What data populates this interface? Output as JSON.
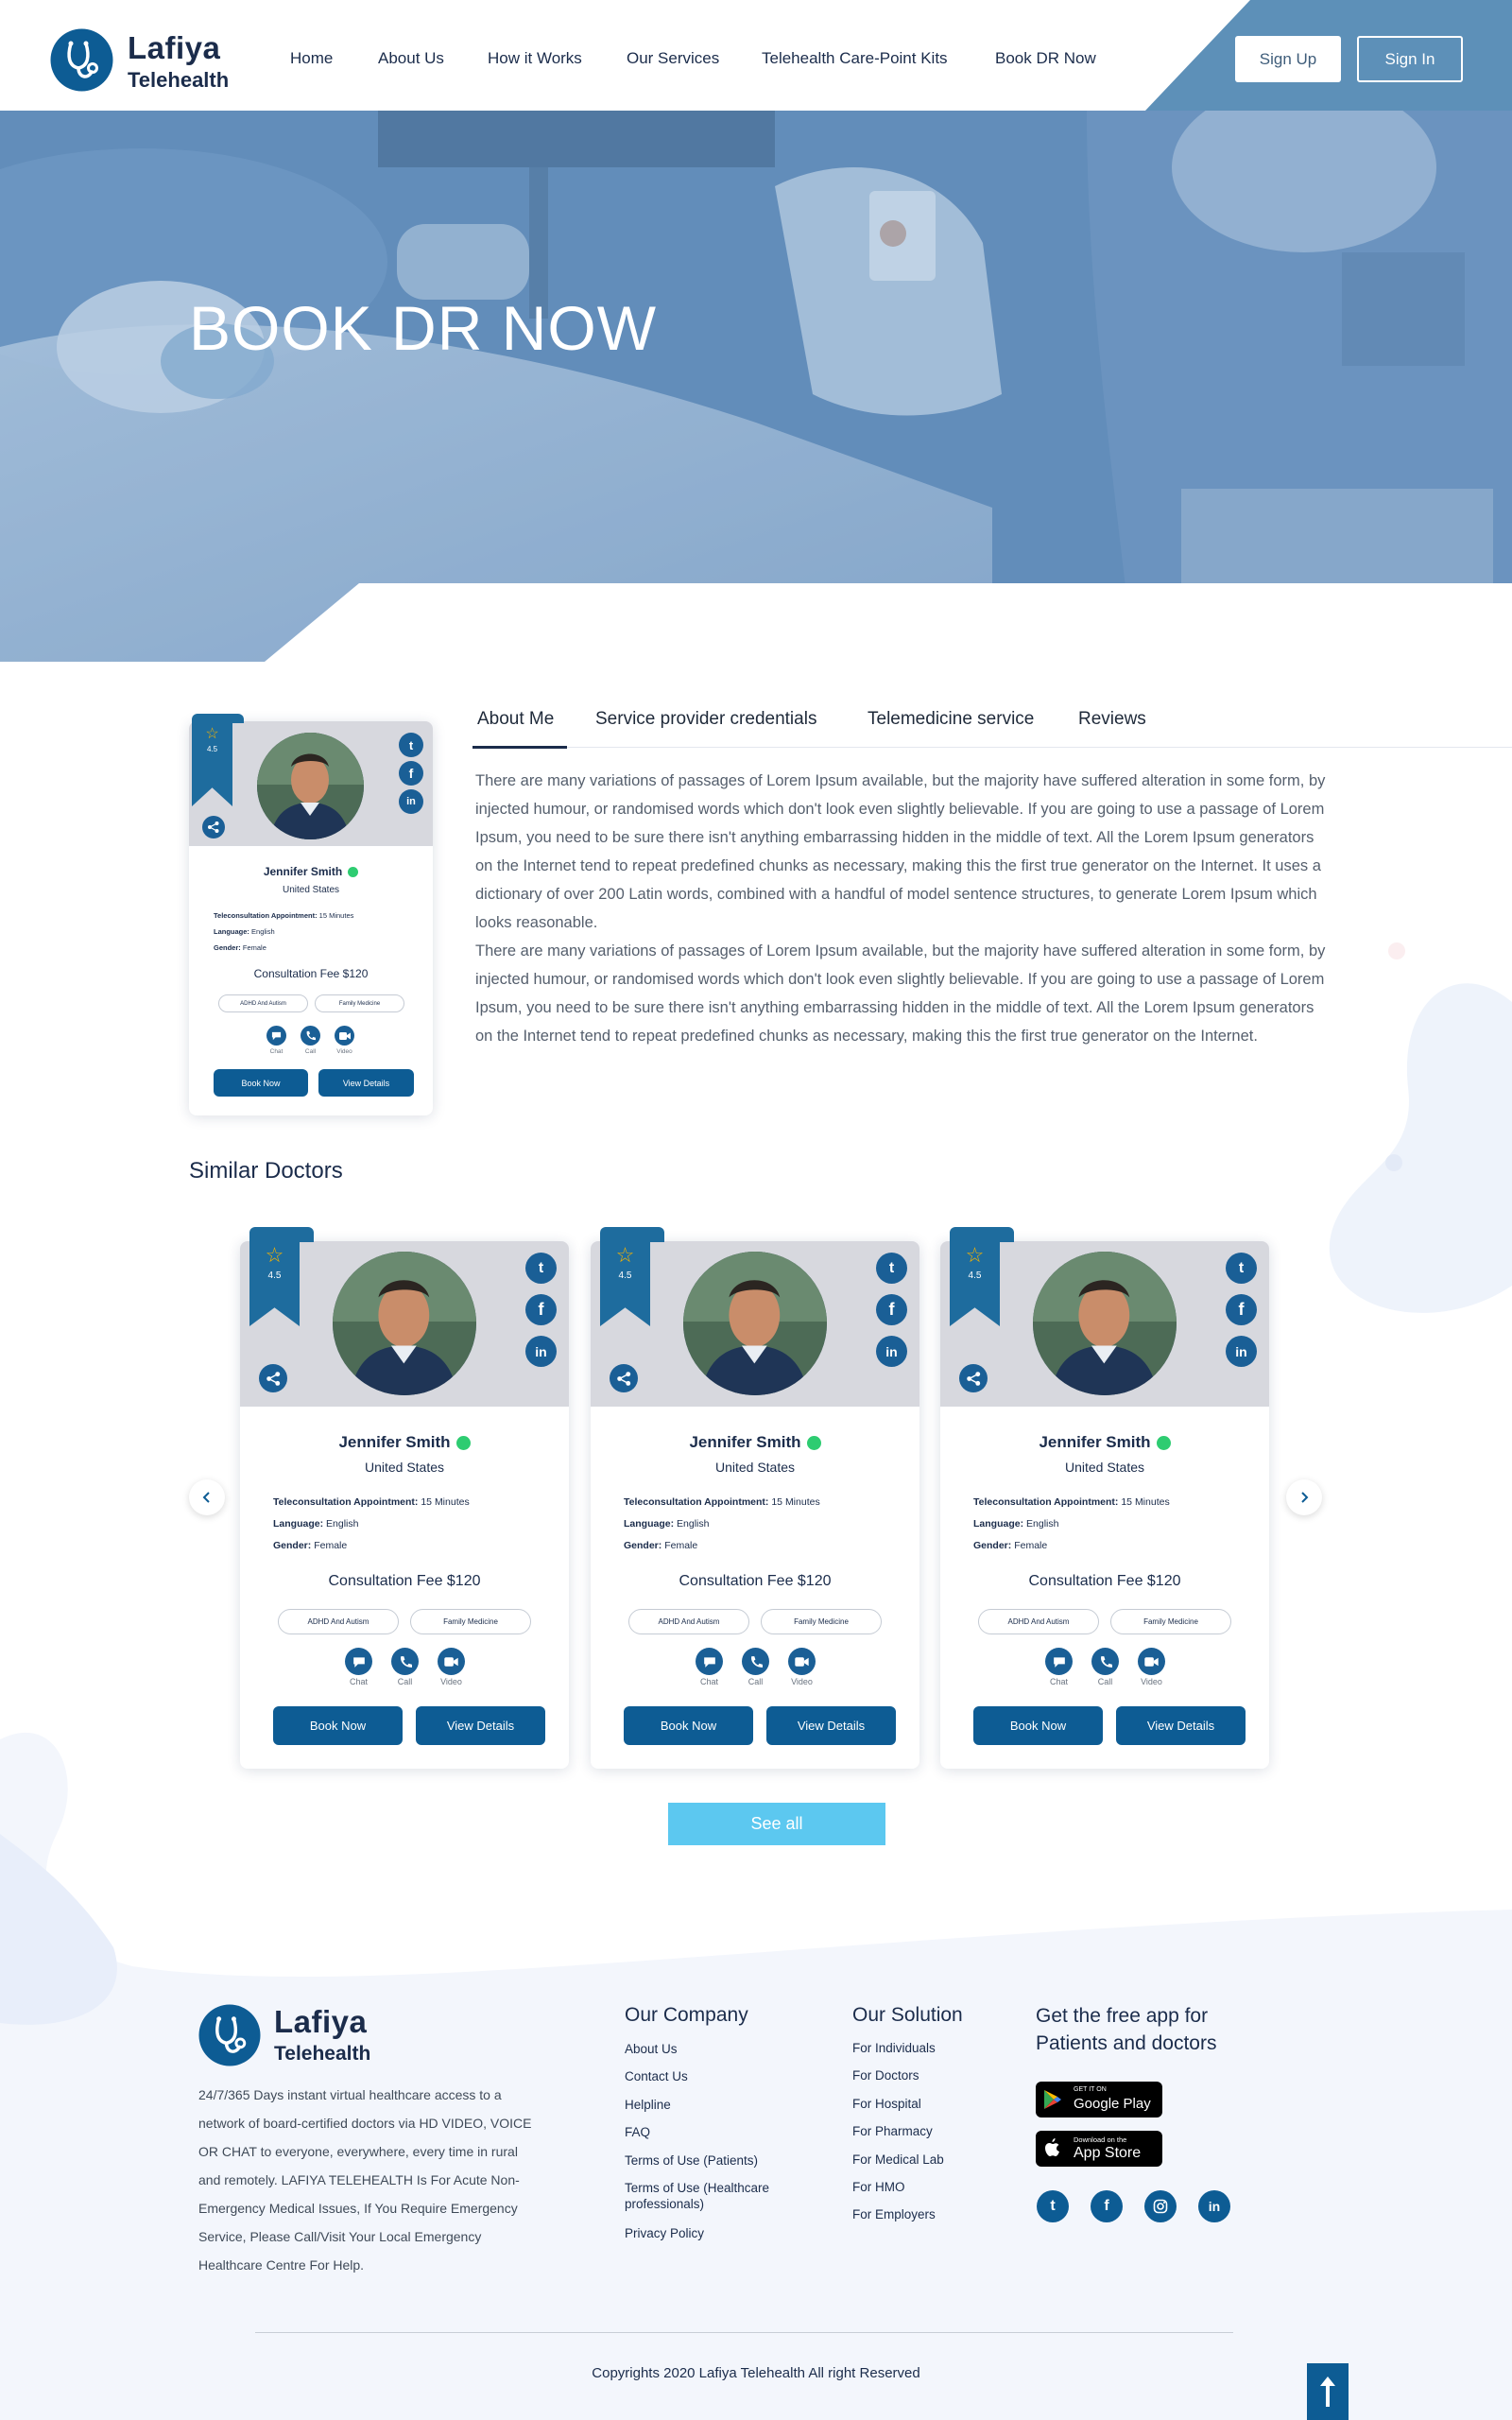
{
  "brand": {
    "name": "Lafiya",
    "sub": "Telehealth"
  },
  "nav": {
    "items": [
      "Home",
      "About Us",
      "How it Works",
      "Our Services",
      "Telehealth Care-Point Kits",
      "Book DR Now"
    ],
    "signup": "Sign Up",
    "signin": "Sign In"
  },
  "hero": {
    "title": "BOOK DR NOW"
  },
  "profile": {
    "tabs": [
      "About Me",
      "Service provider credentials",
      "Telemedicine service",
      "Reviews"
    ],
    "active_tab": "About Me",
    "about_paragraphs": [
      "There are many variations of passages of Lorem Ipsum available, but the majority have suffered alteration in some form, by injected humour, or randomised words which don't look even slightly believable. If you are going to use a passage of Lorem Ipsum, you need to be sure there isn't anything embarrassing hidden in the middle of text. All the Lorem Ipsum generators on the Internet tend to repeat predefined chunks as necessary, making this the first true generator on the Internet. It uses a dictionary of over 200 Latin words, combined with a handful of model sentence structures, to generate Lorem Ipsum which looks reasonable.",
      "There are many variations of passages of Lorem Ipsum available, but the majority have suffered alteration in some form, by injected humour, or randomised words which don't look even slightly believable. If you are going to use a passage of Lorem Ipsum, you need to be sure there isn't anything embarrassing hidden in the middle of text. All the Lorem Ipsum generators on the Internet tend to repeat predefined chunks as necessary, making this the first true generator on the Internet."
    ]
  },
  "doctor": {
    "rating": "4.5",
    "name": "Jennifer Smith",
    "location": "United States",
    "appointment_label": "Teleconsultation Appointment:",
    "appointment_value": "15 Minutes",
    "language_label": "Language:",
    "language_value": "English",
    "gender_label": "Gender:",
    "gender_value": "Female",
    "fee": "Consultation Fee $120",
    "specialties": [
      "ADHD And Autism",
      "Family Medicine"
    ],
    "contact": [
      "Chat",
      "Call",
      "Video"
    ],
    "book_label": "Book Now",
    "details_label": "View Details",
    "social": [
      "twitter-icon",
      "facebook-icon",
      "linkedin-icon"
    ]
  },
  "similar": {
    "title": "Similar Doctors",
    "see_all": "See all"
  },
  "footer": {
    "brand_name": "Lafiya",
    "brand_sub": "Telehealth",
    "description": "24/7/365 Days instant virtual healthcare access to a network of board-certified doctors via HD VIDEO, VOICE OR CHAT to everyone, everywhere, every time in rural and remotely. LAFIYA TELEHEALTH Is For Acute Non-Emergency Medical Issues, If You Require Emergency Service, Please Call/Visit Your Local Emergency Healthcare Centre For Help.",
    "company_title": "Our Company",
    "company_links": [
      "About Us",
      "Contact Us",
      "Helpline",
      "FAQ",
      "Terms of Use (Patients)",
      "Terms of Use (Healthcare professionals)",
      "Privacy Policy"
    ],
    "solution_title": "Our Solution",
    "solution_links": [
      "For Individuals",
      "For Doctors",
      "For Hospital",
      "For Pharmacy",
      "For Medical Lab",
      "For HMO",
      "For Employers"
    ],
    "app_title": "Get the free app for Patients and doctors",
    "google_small": "GET IT ON",
    "google_big": "Google Play",
    "apple_small": "Download on the",
    "apple_big": "App Store",
    "social": [
      "twitter-icon",
      "facebook-icon",
      "instagram-icon",
      "linkedin-icon"
    ],
    "copyright": "Copyrights 2020 Lafiya Telehealth All right Reserved"
  },
  "colors": {
    "primary": "#0d5c94",
    "accent": "#5cc8f0",
    "hero_overlay": "#5e8cb8",
    "online": "#2ecc71",
    "star": "#f5b301"
  }
}
